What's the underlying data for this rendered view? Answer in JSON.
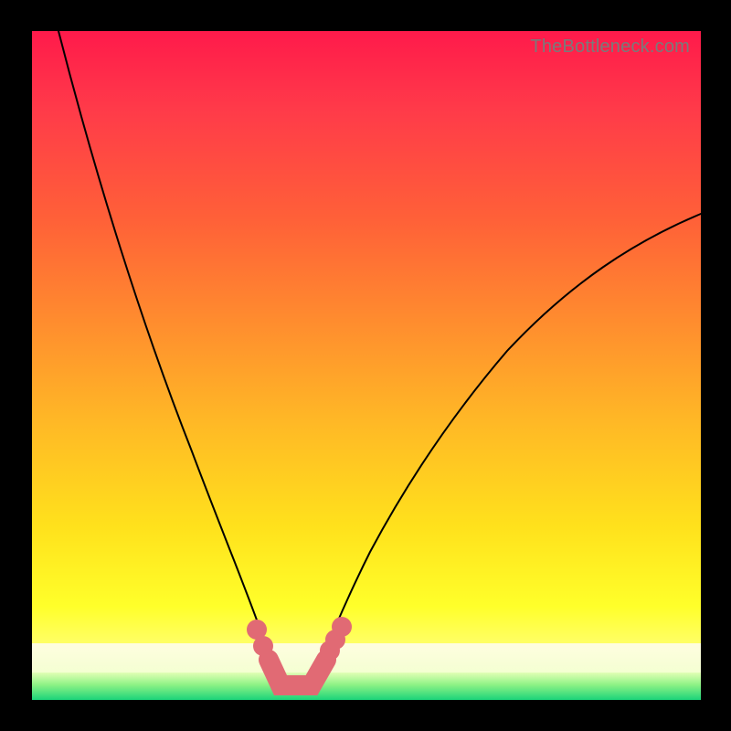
{
  "watermark": "TheBottleneck.com",
  "colors": {
    "curve": "#000000",
    "marker": "#e16a74",
    "gradient_top": "#ff1a4b",
    "gradient_mid": "#ffe11c",
    "gradient_bottom": "#1bd47a",
    "frame": "#000000"
  },
  "chart_data": {
    "type": "line",
    "title": "",
    "xlabel": "",
    "ylabel": "",
    "xlim": [
      0,
      100
    ],
    "ylim": [
      0,
      100
    ],
    "series": [
      {
        "name": "left-curve",
        "x": [
          4,
          10,
          15,
          20,
          25,
          28,
          30,
          32,
          34,
          35.5,
          37
        ],
        "values": [
          100,
          74,
          56,
          41,
          27,
          19,
          14,
          10,
          6,
          4,
          2
        ]
      },
      {
        "name": "right-curve",
        "x": [
          42,
          44,
          47,
          50,
          55,
          60,
          70,
          80,
          90,
          100
        ],
        "values": [
          2,
          4,
          8,
          13,
          22,
          29,
          42,
          53,
          63,
          72
        ]
      },
      {
        "name": "bottleneck-band",
        "x": [
          35.5,
          37,
          41,
          42,
          44,
          45
        ],
        "values": [
          4,
          2,
          2,
          2,
          4,
          6
        ]
      }
    ],
    "markers": [
      {
        "series": "left-curve",
        "x": 33.2,
        "y": 8
      },
      {
        "series": "left-curve",
        "x": 34.3,
        "y": 6
      },
      {
        "series": "right-curve",
        "x": 44.8,
        "y": 5
      },
      {
        "series": "right-curve",
        "x": 45.6,
        "y": 6.5
      },
      {
        "series": "right-curve",
        "x": 46.4,
        "y": 8
      }
    ],
    "grid": false,
    "legend": false
  }
}
